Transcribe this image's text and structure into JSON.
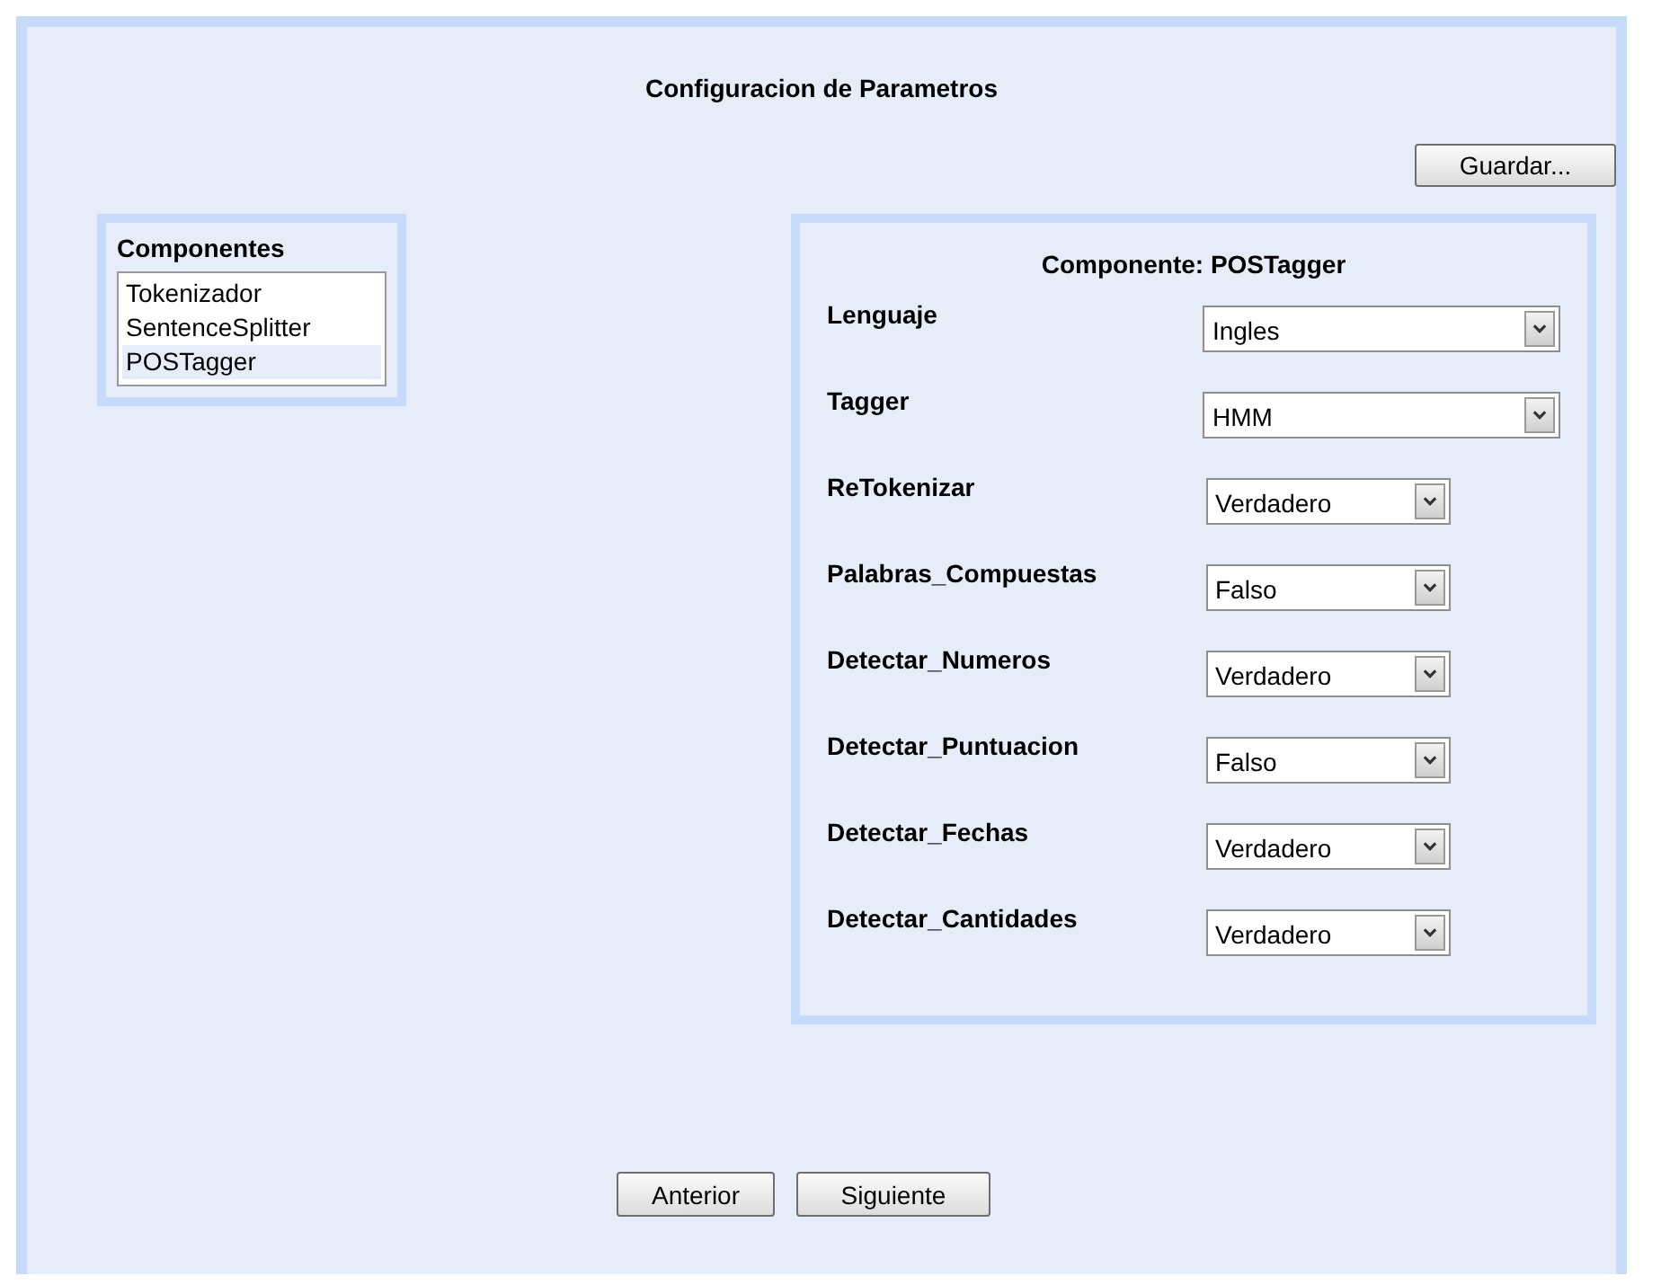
{
  "title": "Configuracion de Parametros",
  "save_button": "Guardar...",
  "components_panel": {
    "title": "Componentes",
    "items": [
      {
        "label": "Tokenizador",
        "selected": false
      },
      {
        "label": "SentenceSplitter",
        "selected": false
      },
      {
        "label": "POSTagger",
        "selected": true
      }
    ]
  },
  "settings_panel": {
    "title": "Componente: POSTagger",
    "parameters": [
      {
        "label": "Lenguaje",
        "value": "Ingles",
        "kind": "wide"
      },
      {
        "label": "Tagger",
        "value": "HMM",
        "kind": "wide"
      },
      {
        "label": "ReTokenizar",
        "value": "Verdadero",
        "kind": "narrow"
      },
      {
        "label": "Palabras_Compuestas",
        "value": "Falso",
        "kind": "narrow"
      },
      {
        "label": "Detectar_Numeros",
        "value": "Verdadero",
        "kind": "narrow"
      },
      {
        "label": "Detectar_Puntuacion",
        "value": "Falso",
        "kind": "narrow"
      },
      {
        "label": "Detectar_Fechas",
        "value": "Verdadero",
        "kind": "narrow"
      },
      {
        "label": "Detectar_Cantidades",
        "value": "Verdadero",
        "kind": "narrow"
      }
    ]
  },
  "nav_buttons": [
    "Anterior",
    "Siguiente"
  ]
}
